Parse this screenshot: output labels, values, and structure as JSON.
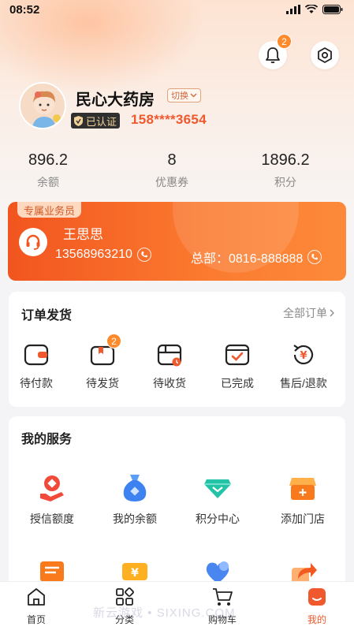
{
  "status_bar": {
    "time": "08:52"
  },
  "header": {
    "notification_count": "2"
  },
  "profile": {
    "store_name": "民心大药房",
    "switch_label": "切换",
    "verified_label": "已认证",
    "phone": "158****3654"
  },
  "stats": [
    {
      "value": "896.2",
      "label": "余额"
    },
    {
      "value": "8",
      "label": "优惠券"
    },
    {
      "value": "1896.2",
      "label": "积分"
    }
  ],
  "agent": {
    "tag": "专属业务员",
    "name": "王思思",
    "phone": "13568963210",
    "hq_phone": "总部：0816-888888"
  },
  "orders": {
    "title": "订单发货",
    "all_label": "全部订单",
    "items": [
      {
        "label": "待付款"
      },
      {
        "label": "待发货",
        "badge": "2"
      },
      {
        "label": "待收货"
      },
      {
        "label": "已完成"
      },
      {
        "label": "售后/退款"
      }
    ]
  },
  "services": {
    "title": "我的服务",
    "items": [
      {
        "label": "授信额度"
      },
      {
        "label": "我的余额"
      },
      {
        "label": "积分中心"
      },
      {
        "label": "添加门店"
      }
    ]
  },
  "tabbar": {
    "items": [
      {
        "label": "首页"
      },
      {
        "label": "分类"
      },
      {
        "label": "购物车"
      },
      {
        "label": "我的"
      }
    ]
  },
  "watermark": "新云游戏 • SIXING.COM",
  "colors": {
    "accent": "#f0592e",
    "orange": "#fb7b30",
    "badge": "#ff8a2b"
  }
}
